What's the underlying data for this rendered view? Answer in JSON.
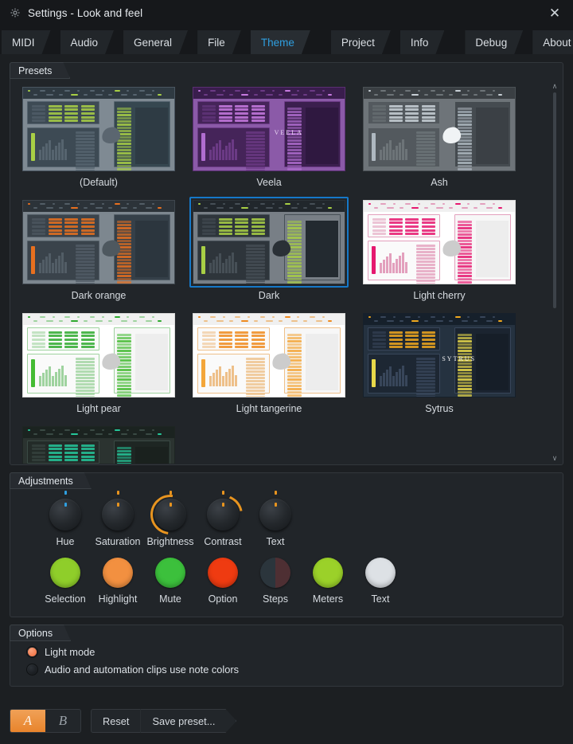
{
  "window": {
    "title": "Settings - Look and feel",
    "gear_icon": "gear-icon",
    "close_icon": "close-icon",
    "close_glyph": "✕"
  },
  "tabs": [
    {
      "label": "MIDI",
      "active": false,
      "gap": false
    },
    {
      "label": "Audio",
      "active": false,
      "gap": false
    },
    {
      "label": "General",
      "active": false,
      "gap": false
    },
    {
      "label": "File",
      "active": false,
      "gap": false
    },
    {
      "label": "Theme",
      "active": true,
      "gap": false
    },
    {
      "label": "Project",
      "active": false,
      "gap": true
    },
    {
      "label": "Info",
      "active": false,
      "gap": false
    },
    {
      "label": "Debug",
      "active": false,
      "gap": true
    },
    {
      "label": "About",
      "active": false,
      "gap": false
    }
  ],
  "presets": {
    "group_title": "Presets",
    "selected": "Dark",
    "scrollbar": {
      "up_glyph": "∧",
      "down_glyph": "∨"
    },
    "items": [
      {
        "label": "(Default)",
        "selected": false,
        "bg": "#7f8a93",
        "frame": "#4a5661",
        "top": "#2f3a42",
        "pane": "#3d4a54",
        "paneline": "#56646f",
        "accent": "#a8cf45",
        "meter": "#a8cf45",
        "pl": "#364750",
        "pl2": "#2e3b44",
        "logo": "#5b6670",
        "word": "",
        "wordcolor": "#ffffff"
      },
      {
        "label": "Veela",
        "selected": false,
        "bg": "#8b5aa8",
        "frame": "#5a2f72",
        "top": "#3a1d4d",
        "pane": "#452459",
        "paneline": "#6b3a85",
        "accent": "#c77ae0",
        "meter": "#b06dd0",
        "pl": "#3b1f4e",
        "pl2": "#2f1840",
        "logo": "",
        "word": "VEELA",
        "wordcolor": "#e8d5f2"
      },
      {
        "label": "Ash",
        "selected": false,
        "bg": "#6e7479",
        "frame": "#4b5155",
        "top": "#3a3f43",
        "pane": "#53595e",
        "paneline": "#6d7478",
        "accent": "#c8d0d6",
        "meter": "#aeb8c0",
        "pl": "#454b50",
        "pl2": "#3b4045",
        "logo": "#f0f3f5",
        "word": "",
        "wordcolor": "#ffffff"
      },
      {
        "label": "Dark orange",
        "selected": false,
        "bg": "#7d878f",
        "frame": "#3e464d",
        "top": "#2c3339",
        "pane": "#3a434b",
        "paneline": "#525d66",
        "accent": "#e8701f",
        "meter": "#e8701f",
        "pl": "#354049",
        "pl2": "#2c363e",
        "logo": "#4e585f",
        "word": "",
        "wordcolor": "#ffffff"
      },
      {
        "label": "Dark",
        "selected": true,
        "bg": "#787f86",
        "frame": "#2c3338",
        "top": "#21272c",
        "pane": "#2e353b",
        "paneline": "#464f56",
        "accent": "#a8cf45",
        "meter": "#a8cf45",
        "pl": "#2a3views",
        "pl2": "#232a30",
        "logo": "#2a3036",
        "word": "",
        "wordcolor": "#ffffff"
      },
      {
        "label": "Light cherry",
        "selected": false,
        "bg": "#ffffff",
        "frame": "#d8d8d8",
        "top": "#f0f0f0",
        "pane": "#fafafa",
        "paneline": "#e3a0bd",
        "accent": "#e5186f",
        "meter": "#e5186f",
        "pl": "#f7f7f7",
        "pl2": "#ededed",
        "logo": "#cccccc",
        "word": "",
        "wordcolor": "#333333"
      },
      {
        "label": "Light pear",
        "selected": false,
        "bg": "#ffffff",
        "frame": "#d8d8d8",
        "top": "#f0f0f0",
        "pane": "#fafafa",
        "paneline": "#9fd39f",
        "accent": "#2faa2f",
        "meter": "#44bb33",
        "pl": "#f7f7f7",
        "pl2": "#ededed",
        "logo": "#cccccc",
        "word": "",
        "wordcolor": "#333333"
      },
      {
        "label": "Light tangerine",
        "selected": false,
        "bg": "#ffffff",
        "frame": "#d8d8d8",
        "top": "#f0f0f0",
        "pane": "#fafafa",
        "paneline": "#eec08a",
        "accent": "#ef8b1f",
        "meter": "#f3a63a",
        "pl": "#f7f7f7",
        "pl2": "#ededed",
        "logo": "#cccccc",
        "word": "",
        "wordcolor": "#333333"
      },
      {
        "label": "Sytrus",
        "selected": false,
        "bg": "#253240",
        "frame": "#16202b",
        "top": "#16202b",
        "pane": "#1d2733",
        "paneline": "#38465a",
        "accent": "#f0a81e",
        "meter": "#e8d94a",
        "pl": "#1b2430",
        "pl2": "#161e28",
        "logo": "",
        "word": "SYTRUS",
        "wordcolor": "#f2f2f2"
      },
      {
        "label": "",
        "selected": false,
        "bg": "#2b3330",
        "frame": "#1e2522",
        "top": "#1b2320",
        "pane": "#232b28",
        "paneline": "#3a4a44",
        "accent": "#25c79a",
        "meter": "#25c79a",
        "pl": "#1e2623",
        "pl2": "#1a211e",
        "logo": "#2b3330",
        "word": "",
        "wordcolor": "#ffffff"
      }
    ]
  },
  "adjustments": {
    "group_title": "Adjustments",
    "knobs": [
      {
        "label": "Hue",
        "marker_color": "#2f9fe0",
        "arc": "none",
        "arc_color": "#2f9fe0"
      },
      {
        "label": "Saturation",
        "marker_color": "#e8941f",
        "arc": "none",
        "arc_color": "#e8941f"
      },
      {
        "label": "Brightness",
        "marker_color": "#e8941f",
        "arc": "left",
        "arc_color": "#e8941f"
      },
      {
        "label": "Contrast",
        "marker_color": "#e8941f",
        "arc": "top",
        "arc_color": "#e8941f"
      },
      {
        "label": "Text",
        "marker_color": "#e8941f",
        "arc": "none",
        "arc_color": "#e8941f"
      }
    ],
    "swatches": [
      {
        "label": "Selection",
        "color": "#8fce2a",
        "color2": ""
      },
      {
        "label": "Highlight",
        "color": "#f29040",
        "color2": ""
      },
      {
        "label": "Mute",
        "color": "#3cc03c",
        "color2": ""
      },
      {
        "label": "Option",
        "color": "#ef3b11",
        "color2": ""
      },
      {
        "label": "Steps",
        "color": "#2b353c",
        "color2": "#4e2f33"
      },
      {
        "label": "Meters",
        "color": "#9bd129",
        "color2": ""
      },
      {
        "label": "Text",
        "color": "#dde1e5",
        "color2": ""
      }
    ]
  },
  "options": {
    "group_title": "Options",
    "items": [
      {
        "label": "Light mode",
        "checked": true,
        "fill": "#f06a3a"
      },
      {
        "label": "Audio and automation clips use note colors",
        "checked": false,
        "fill": "#1d2125"
      }
    ]
  },
  "bottom": {
    "ab": [
      {
        "label": "A",
        "active": true
      },
      {
        "label": "B",
        "active": false
      }
    ],
    "reset_label": "Reset",
    "save_preset_label": "Save preset..."
  }
}
